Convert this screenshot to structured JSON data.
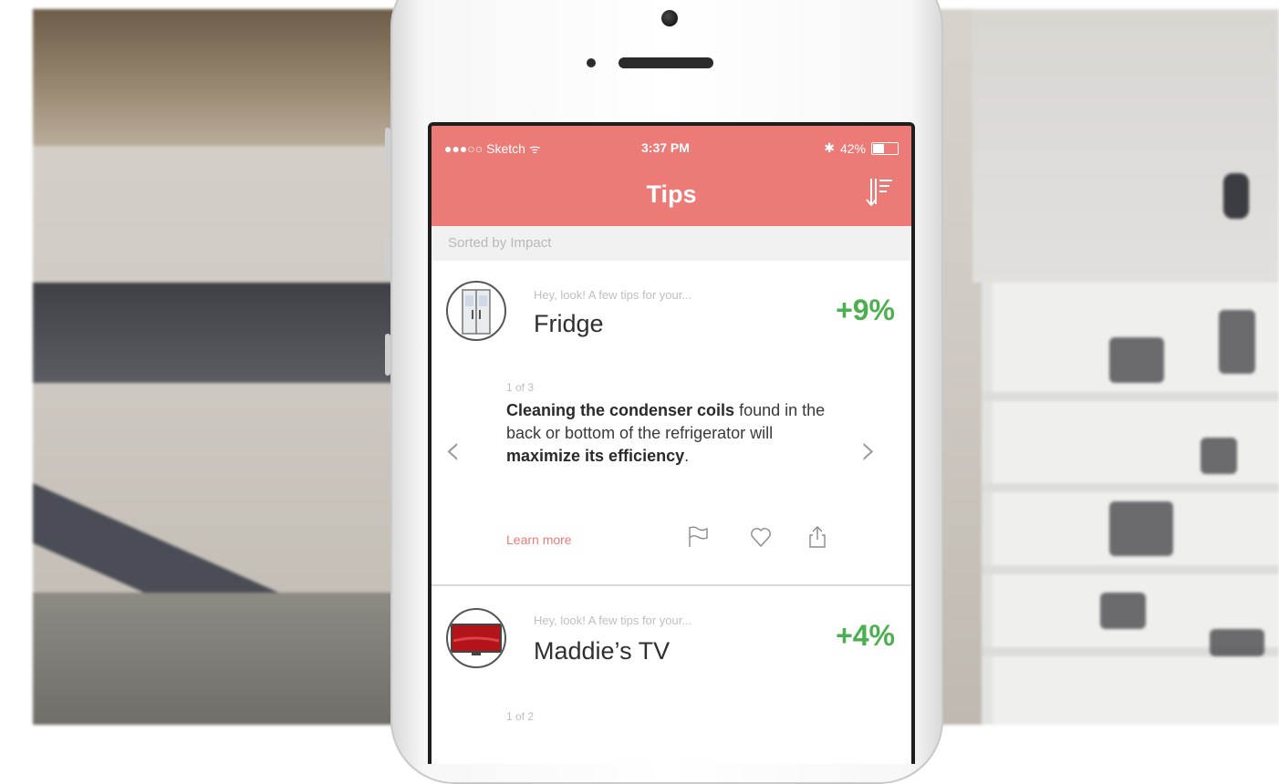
{
  "status_bar": {
    "carrier": "●●●○○ Sketch ᯤ",
    "time": "3:37 PM",
    "battery": "42%"
  },
  "nav": {
    "title": "Tips"
  },
  "sort_label": "Sorted by Impact",
  "cards": [
    {
      "eyebrow": "Hey, look! A few tips for your...",
      "name": "Fridge",
      "impact": "+9%",
      "counter": "1 of 3",
      "tip_parts": {
        "p1": "Cleaning the condenser coils",
        "p2": " found in the back or bottom of the refrigerator will ",
        "p3": "maximize its efficiency",
        "p4": "."
      },
      "learn_more": "Learn more"
    },
    {
      "eyebrow": "Hey, look! A few tips for your...",
      "name": "Maddie’s TV",
      "impact": "+4%",
      "counter": "1 of 2"
    }
  ],
  "colors": {
    "accent": "#ec7b78",
    "impact": "#4caf50"
  },
  "icons": {
    "sort": "sort-icon",
    "prev": "chevron-left-icon",
    "next": "chevron-right-icon",
    "flag": "flag-icon",
    "like": "heart-icon",
    "share": "share-icon"
  }
}
